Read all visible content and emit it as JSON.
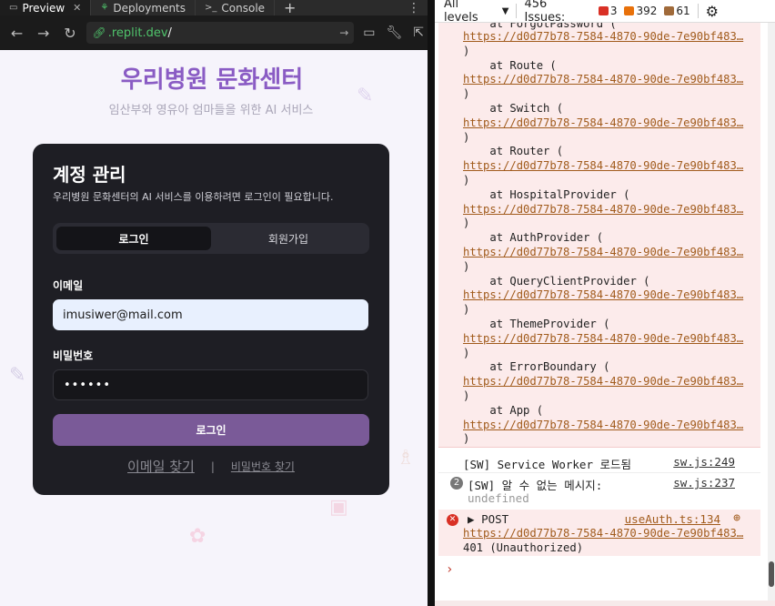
{
  "tabs": [
    {
      "label": "Preview",
      "icon": "preview-icon",
      "active": true
    },
    {
      "label": "Deployments",
      "icon": "deployments-icon",
      "active": false
    },
    {
      "label": "Console",
      "icon": "console-icon",
      "active": false
    }
  ],
  "address": {
    "host": ".replit.dev",
    "path": "/"
  },
  "app": {
    "brand": "우리병원 문화센터",
    "tagline": "임산부와 영유아 엄마들을 위한 AI 서비스",
    "card": {
      "title": "계정 관리",
      "subtitle": "우리병원 문화센터의 AI 서비스를 이용하려면 로그인이 필요합니다.",
      "tab_login": "로그인",
      "tab_signup": "회원가입",
      "email_label": "이메일",
      "email_value": "imusiwer@mail.com",
      "password_label": "비밀번호",
      "password_value": "••••••",
      "submit_label": "로그인",
      "find_email": "이메일 찾기",
      "separator": "|",
      "find_password": "비밀번호 찾기"
    }
  },
  "console": {
    "levels": "All levels",
    "issues_label": "456 Issues:",
    "error_count": "3",
    "warning_count": "392",
    "info_count": "61",
    "trace_top": "at ForgotPassword (",
    "trace": [
      {
        "frame": "",
        "url": "https://d0d77b78-7584-4870-90de-7e90bf483…"
      },
      {
        "frame": "at Route (",
        "url": "https://d0d77b78-7584-4870-90de-7e90bf483…"
      },
      {
        "frame": "at Switch (",
        "url": "https://d0d77b78-7584-4870-90de-7e90bf483…"
      },
      {
        "frame": "at Router (",
        "url": "https://d0d77b78-7584-4870-90de-7e90bf483…"
      },
      {
        "frame": "at HospitalProvider (",
        "url": "https://d0d77b78-7584-4870-90de-7e90bf483…"
      },
      {
        "frame": "at AuthProvider (",
        "url": "https://d0d77b78-7584-4870-90de-7e90bf483…"
      },
      {
        "frame": "at QueryClientProvider (",
        "url": "https://d0d77b78-7584-4870-90de-7e90bf483…"
      },
      {
        "frame": "at ThemeProvider (",
        "url": "https://d0d77b78-7584-4870-90de-7e90bf483…"
      },
      {
        "frame": "at ErrorBoundary (",
        "url": "https://d0d77b78-7584-4870-90de-7e90bf483…"
      },
      {
        "frame": "at App (",
        "url": "https://d0d77b78-7584-4870-90de-7e90bf483…"
      }
    ],
    "sw_loaded": "[SW] Service Worker 로드됨",
    "sw_loaded_src": "sw.js:249",
    "sw_unknown_count": "2",
    "sw_unknown": "[SW] 알 수 없는 메시지:",
    "sw_unknown_src": "sw.js:237",
    "sw_unknown_value": "undefined",
    "post_method": "POST",
    "post_src": "useAuth.ts:134",
    "post_url": "https://d0d77b78-7584-4870-90de-7e90bf483…",
    "post_status": "401 (Unauthorized)",
    "prompt": "›"
  },
  "colors": {
    "brand": "#8a5cc4",
    "submit": "#7a5a98",
    "error_bg": "#fcebeb",
    "link": "#a15b1c"
  }
}
